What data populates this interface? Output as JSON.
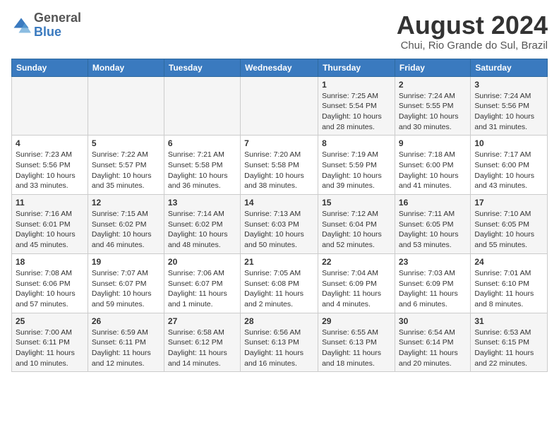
{
  "header": {
    "logo_general": "General",
    "logo_blue": "Blue",
    "month_title": "August 2024",
    "location": "Chui, Rio Grande do Sul, Brazil"
  },
  "days_of_week": [
    "Sunday",
    "Monday",
    "Tuesday",
    "Wednesday",
    "Thursday",
    "Friday",
    "Saturday"
  ],
  "weeks": [
    [
      {
        "num": "",
        "info": ""
      },
      {
        "num": "",
        "info": ""
      },
      {
        "num": "",
        "info": ""
      },
      {
        "num": "",
        "info": ""
      },
      {
        "num": "1",
        "info": "Sunrise: 7:25 AM\nSunset: 5:54 PM\nDaylight: 10 hours and 28 minutes."
      },
      {
        "num": "2",
        "info": "Sunrise: 7:24 AM\nSunset: 5:55 PM\nDaylight: 10 hours and 30 minutes."
      },
      {
        "num": "3",
        "info": "Sunrise: 7:24 AM\nSunset: 5:56 PM\nDaylight: 10 hours and 31 minutes."
      }
    ],
    [
      {
        "num": "4",
        "info": "Sunrise: 7:23 AM\nSunset: 5:56 PM\nDaylight: 10 hours and 33 minutes."
      },
      {
        "num": "5",
        "info": "Sunrise: 7:22 AM\nSunset: 5:57 PM\nDaylight: 10 hours and 35 minutes."
      },
      {
        "num": "6",
        "info": "Sunrise: 7:21 AM\nSunset: 5:58 PM\nDaylight: 10 hours and 36 minutes."
      },
      {
        "num": "7",
        "info": "Sunrise: 7:20 AM\nSunset: 5:58 PM\nDaylight: 10 hours and 38 minutes."
      },
      {
        "num": "8",
        "info": "Sunrise: 7:19 AM\nSunset: 5:59 PM\nDaylight: 10 hours and 39 minutes."
      },
      {
        "num": "9",
        "info": "Sunrise: 7:18 AM\nSunset: 6:00 PM\nDaylight: 10 hours and 41 minutes."
      },
      {
        "num": "10",
        "info": "Sunrise: 7:17 AM\nSunset: 6:00 PM\nDaylight: 10 hours and 43 minutes."
      }
    ],
    [
      {
        "num": "11",
        "info": "Sunrise: 7:16 AM\nSunset: 6:01 PM\nDaylight: 10 hours and 45 minutes."
      },
      {
        "num": "12",
        "info": "Sunrise: 7:15 AM\nSunset: 6:02 PM\nDaylight: 10 hours and 46 minutes."
      },
      {
        "num": "13",
        "info": "Sunrise: 7:14 AM\nSunset: 6:02 PM\nDaylight: 10 hours and 48 minutes."
      },
      {
        "num": "14",
        "info": "Sunrise: 7:13 AM\nSunset: 6:03 PM\nDaylight: 10 hours and 50 minutes."
      },
      {
        "num": "15",
        "info": "Sunrise: 7:12 AM\nSunset: 6:04 PM\nDaylight: 10 hours and 52 minutes."
      },
      {
        "num": "16",
        "info": "Sunrise: 7:11 AM\nSunset: 6:05 PM\nDaylight: 10 hours and 53 minutes."
      },
      {
        "num": "17",
        "info": "Sunrise: 7:10 AM\nSunset: 6:05 PM\nDaylight: 10 hours and 55 minutes."
      }
    ],
    [
      {
        "num": "18",
        "info": "Sunrise: 7:08 AM\nSunset: 6:06 PM\nDaylight: 10 hours and 57 minutes."
      },
      {
        "num": "19",
        "info": "Sunrise: 7:07 AM\nSunset: 6:07 PM\nDaylight: 10 hours and 59 minutes."
      },
      {
        "num": "20",
        "info": "Sunrise: 7:06 AM\nSunset: 6:07 PM\nDaylight: 11 hours and 1 minute."
      },
      {
        "num": "21",
        "info": "Sunrise: 7:05 AM\nSunset: 6:08 PM\nDaylight: 11 hours and 2 minutes."
      },
      {
        "num": "22",
        "info": "Sunrise: 7:04 AM\nSunset: 6:09 PM\nDaylight: 11 hours and 4 minutes."
      },
      {
        "num": "23",
        "info": "Sunrise: 7:03 AM\nSunset: 6:09 PM\nDaylight: 11 hours and 6 minutes."
      },
      {
        "num": "24",
        "info": "Sunrise: 7:01 AM\nSunset: 6:10 PM\nDaylight: 11 hours and 8 minutes."
      }
    ],
    [
      {
        "num": "25",
        "info": "Sunrise: 7:00 AM\nSunset: 6:11 PM\nDaylight: 11 hours and 10 minutes."
      },
      {
        "num": "26",
        "info": "Sunrise: 6:59 AM\nSunset: 6:11 PM\nDaylight: 11 hours and 12 minutes."
      },
      {
        "num": "27",
        "info": "Sunrise: 6:58 AM\nSunset: 6:12 PM\nDaylight: 11 hours and 14 minutes."
      },
      {
        "num": "28",
        "info": "Sunrise: 6:56 AM\nSunset: 6:13 PM\nDaylight: 11 hours and 16 minutes."
      },
      {
        "num": "29",
        "info": "Sunrise: 6:55 AM\nSunset: 6:13 PM\nDaylight: 11 hours and 18 minutes."
      },
      {
        "num": "30",
        "info": "Sunrise: 6:54 AM\nSunset: 6:14 PM\nDaylight: 11 hours and 20 minutes."
      },
      {
        "num": "31",
        "info": "Sunrise: 6:53 AM\nSunset: 6:15 PM\nDaylight: 11 hours and 22 minutes."
      }
    ]
  ]
}
